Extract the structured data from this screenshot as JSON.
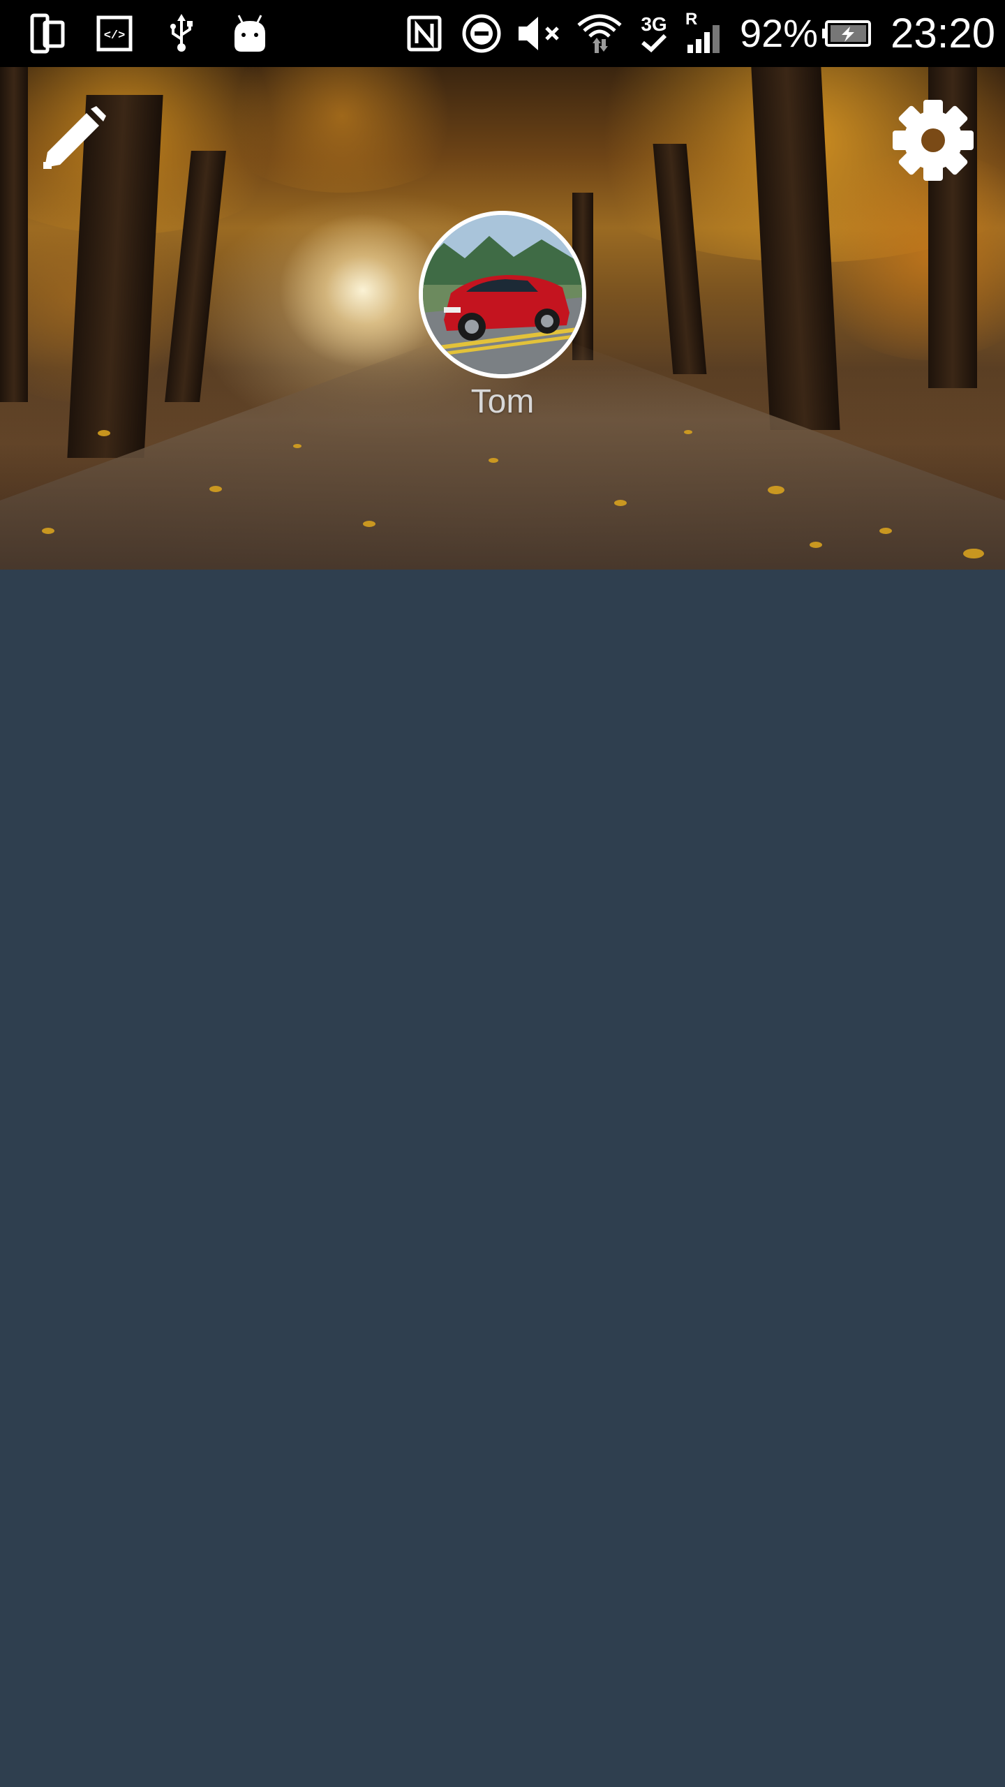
{
  "status_bar": {
    "battery_percent": "92%",
    "time": "23:20",
    "network_type": "3G",
    "roaming_indicator": "R",
    "icons": [
      "phone-tablet-icon",
      "developer-code-icon",
      "usb-icon",
      "android-debug-icon",
      "nfc-icon",
      "do-not-disturb-icon",
      "mute-icon",
      "wifi-icon",
      "3g-data-icon",
      "signal-icon",
      "battery-charging-icon"
    ]
  },
  "header": {
    "edit_icon": "pencil-icon",
    "settings_icon": "gear-icon"
  },
  "profile": {
    "name": "Tom"
  },
  "colors": {
    "background": "#2f3f4f",
    "avatar_border": "#ffffff",
    "status_bar": "#000000"
  }
}
